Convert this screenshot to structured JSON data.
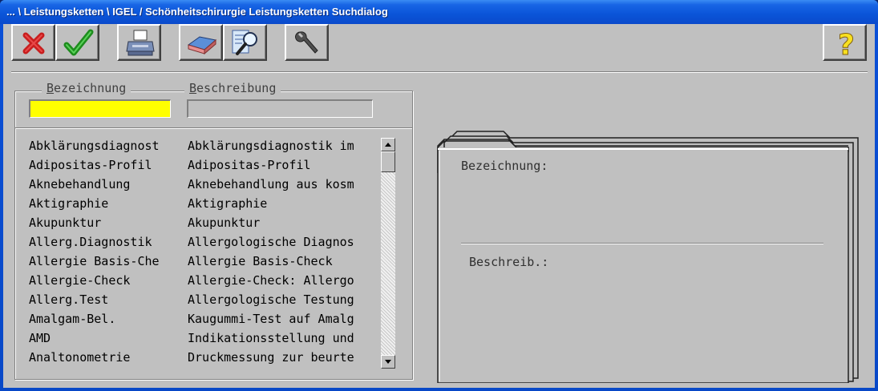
{
  "window": {
    "title": "... \\ Leistungsketten \\ IGEL / Schönheitschirurgie Leistungsketten Suchdialog"
  },
  "toolbar": {
    "buttons": [
      {
        "icon": "cancel-x-icon"
      },
      {
        "icon": "confirm-check-icon"
      },
      {
        "icon": "printer-icon"
      },
      {
        "icon": "eraser-icon"
      },
      {
        "icon": "search-magnifier-icon"
      },
      {
        "icon": "wrench-icon"
      },
      {
        "icon": "help-question-icon"
      }
    ]
  },
  "search": {
    "bezeichnung_label_first": "B",
    "bezeichnung_label_rest": "ezeichnung",
    "beschreibung_label_first": "B",
    "beschreibung_label_rest": "eschreibung",
    "bezeichnung_value": "",
    "beschreibung_value": ""
  },
  "list": {
    "rows": [
      {
        "bezeichnung": "Abklärungsdiagnost",
        "beschreibung": "Abklärungsdiagnostik im"
      },
      {
        "bezeichnung": "Adipositas-Profil",
        "beschreibung": "Adipositas-Profil"
      },
      {
        "bezeichnung": "Aknebehandlung",
        "beschreibung": "Aknebehandlung aus kosm"
      },
      {
        "bezeichnung": "Aktigraphie",
        "beschreibung": "Aktigraphie"
      },
      {
        "bezeichnung": "Akupunktur",
        "beschreibung": "Akupunktur"
      },
      {
        "bezeichnung": "Allerg.Diagnostik",
        "beschreibung": "Allergologische Diagnos"
      },
      {
        "bezeichnung": "Allergie Basis-Che",
        "beschreibung": "Allergie Basis-Check"
      },
      {
        "bezeichnung": "Allergie-Check",
        "beschreibung": "Allergie-Check: Allergo"
      },
      {
        "bezeichnung": "Allerg.Test",
        "beschreibung": "Allergologische Testung"
      },
      {
        "bezeichnung": "Amalgam-Bel.",
        "beschreibung": "Kaugummi-Test auf Amalg"
      },
      {
        "bezeichnung": "AMD",
        "beschreibung": "Indikationsstellung und"
      },
      {
        "bezeichnung": "Analtonometrie",
        "beschreibung": "Druckmessung zur beurte"
      }
    ]
  },
  "details": {
    "bezeichnung_label": "Bezeichnung:",
    "beschreibung_label": "Beschreib.:"
  },
  "colors": {
    "titlebar": "#0a54d8",
    "client_bg": "#c0c0c0",
    "input_highlight": "#ffff00"
  }
}
